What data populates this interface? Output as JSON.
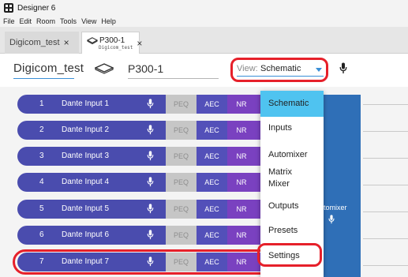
{
  "window": {
    "title": "Designer 6"
  },
  "menubar": [
    "File",
    "Edit",
    "Room",
    "Tools",
    "View",
    "Help"
  ],
  "tabs": [
    {
      "label": "Digicom_test",
      "close": "×"
    },
    {
      "label": "P300-1",
      "sublabel": "Digicom_test",
      "close": "×"
    }
  ],
  "header": {
    "project_name": "Digicom_test",
    "device_name": "P300-1",
    "view_label": "View:",
    "view_value": "Schematic"
  },
  "strips": [
    {
      "num": "1",
      "label": "Dante Input 1"
    },
    {
      "num": "2",
      "label": "Dante Input 2"
    },
    {
      "num": "3",
      "label": "Dante Input 3"
    },
    {
      "num": "4",
      "label": "Dante Input 4"
    },
    {
      "num": "5",
      "label": "Dante Input 5"
    },
    {
      "num": "6",
      "label": "Dante Input 6"
    },
    {
      "num": "7",
      "label": "Dante Input 7"
    }
  ],
  "blocks": {
    "peq": "PEQ",
    "aec": "AEC",
    "nr": "NR"
  },
  "automixer": {
    "label": "utomixer"
  },
  "dropdown": {
    "items": [
      "Schematic",
      "Inputs",
      "Automixer",
      "Matrix Mixer",
      "Outputs",
      "Presets",
      "Settings"
    ],
    "matrix_line1": "Matrix",
    "matrix_line2": "Mixer",
    "selected": "Schematic"
  },
  "colors": {
    "strip_blue": "#4a4cae",
    "aec_blue": "#5350b9",
    "nr_purple": "#7a41c0",
    "peq_gray": "#c6c6c6",
    "automixer_blue": "#2f6fb7",
    "selected_cyan": "#4fc3f0",
    "highlight_red": "#e6202a",
    "accent_blue": "#3a8fd6"
  },
  "icons": {
    "app": "app-grid-icon",
    "device": "device-diamond-icon",
    "mic": "microphone-icon",
    "caret": "chevron-down-icon"
  }
}
